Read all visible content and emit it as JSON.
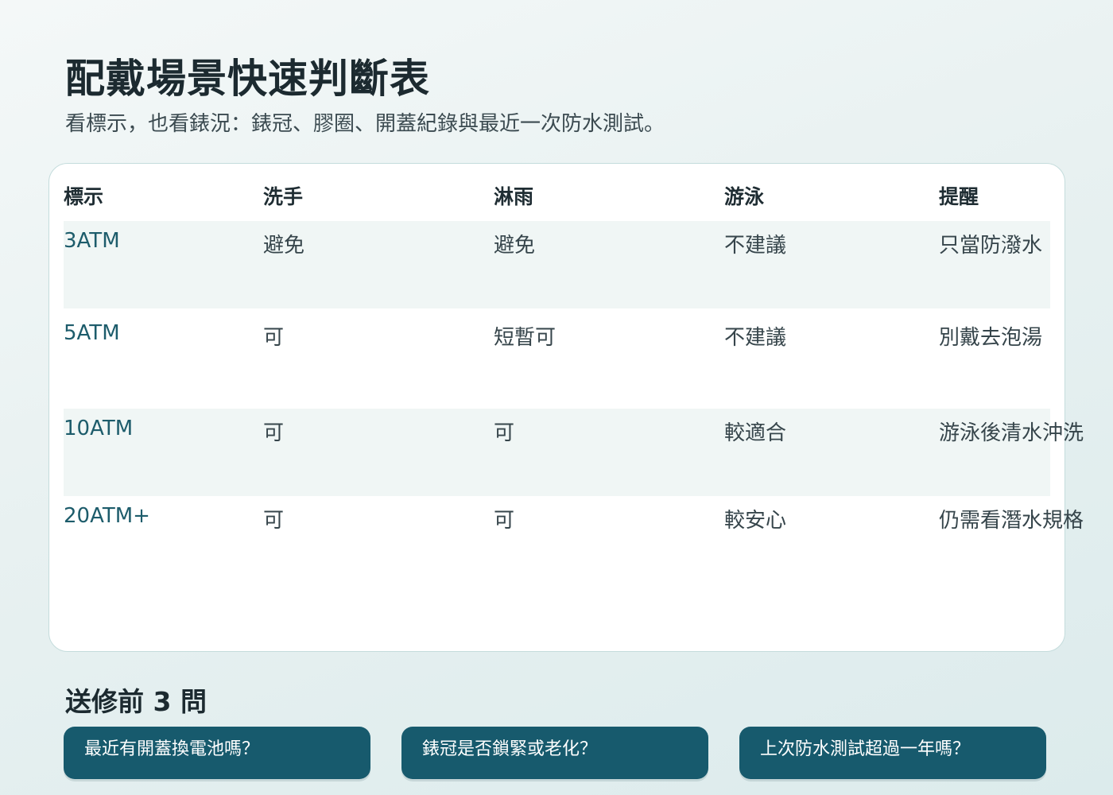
{
  "header": {
    "title": "配戴場景快速判斷表",
    "subtitle": "看標示，也看錶況：錶冠、膠圈、開蓋紀錄與最近一次防水測試。"
  },
  "table": {
    "columns": [
      "標示",
      "洗手",
      "淋雨",
      "游泳",
      "提醒"
    ],
    "rows": [
      [
        "3ATM",
        "避免",
        "避免",
        "不建議",
        "只當防潑水"
      ],
      [
        "5ATM",
        "可",
        "短暫可",
        "不建議",
        "別戴去泡湯"
      ],
      [
        "10ATM",
        "可",
        "可",
        "較適合",
        "游泳後清水沖洗"
      ],
      [
        "20ATM+",
        "可",
        "可",
        "較安心",
        "仍需看潛水規格"
      ]
    ]
  },
  "checklist": {
    "title": "送修前 3 問",
    "questions": [
      "最近有開蓋換電池嗎？",
      "錶冠是否鎖緊或老化？",
      "上次防水測試超過一年嗎？"
    ]
  },
  "colors": {
    "accent": "#175a6d",
    "rating_text": "#1d5c6b",
    "row_shade": "#f0f6f5"
  }
}
